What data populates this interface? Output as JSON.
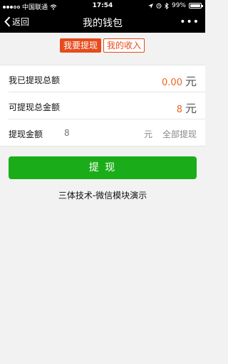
{
  "status_bar": {
    "carrier": "中国联通",
    "time": "17:54",
    "battery_percent": "99%",
    "battery_level": 0.99
  },
  "nav": {
    "back_label": "返回",
    "title": "我的钱包",
    "more_label": "•••"
  },
  "tabs": [
    {
      "label": "我要提现",
      "active": true
    },
    {
      "label": "我的收入",
      "active": false
    }
  ],
  "rows": {
    "total_withdrawn": {
      "label": "我已提现总额",
      "value": "0.00",
      "unit": "元"
    },
    "available": {
      "label": "可提现总金额",
      "value": "8",
      "unit": "元"
    },
    "amount": {
      "label": "提现金额",
      "placeholder": "8",
      "unit": "元",
      "action": "全部提现"
    }
  },
  "submit_label": "提 现",
  "footnote": "三体技术-微信模块演示",
  "colors": {
    "accent": "#e64b1c",
    "value": "#f0661e",
    "button": "#1aad19"
  }
}
